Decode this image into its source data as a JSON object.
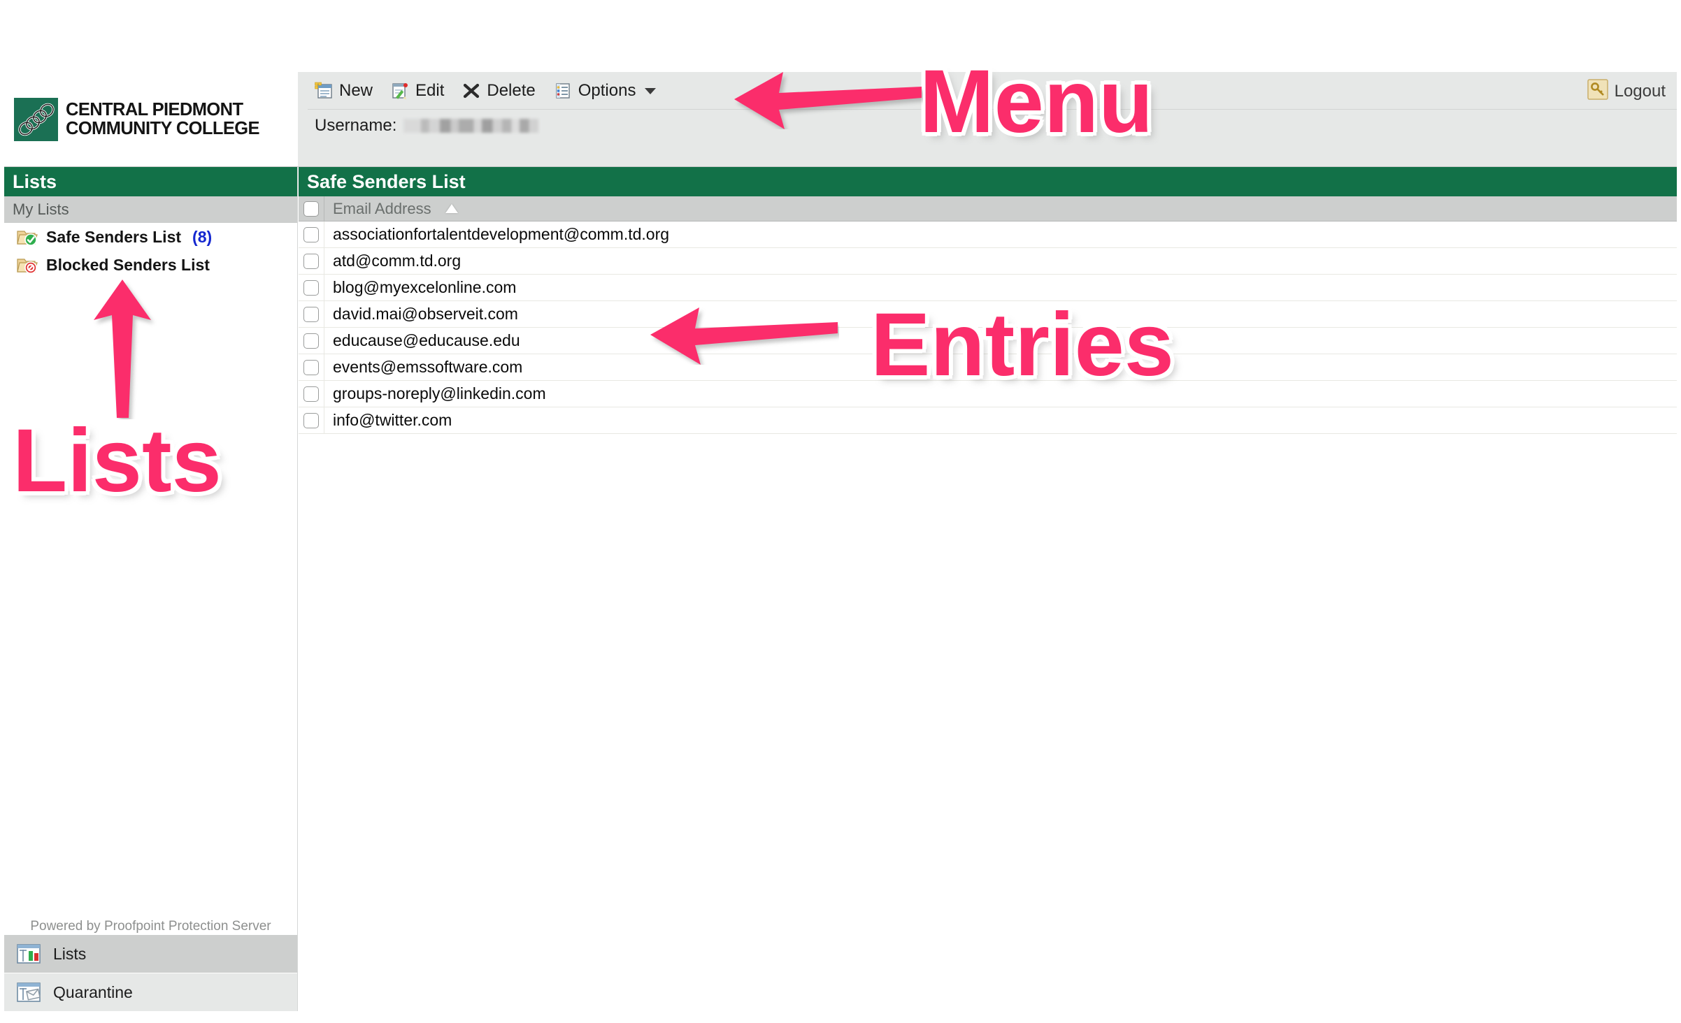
{
  "brand": {
    "logo_line1": "CENTRAL PIEDMONT",
    "logo_line2": "COMMUNITY COLLEGE",
    "logo_mark_alt": "cpcc-logo-icon",
    "green": "#127148"
  },
  "toolbar": {
    "items": [
      {
        "label": "New",
        "icon": "new-document-icon"
      },
      {
        "label": "Edit",
        "icon": "edit-pencil-icon"
      },
      {
        "label": "Delete",
        "icon": "delete-x-icon"
      },
      {
        "label": "Options",
        "icon": "options-list-icon",
        "has_caret": true
      }
    ],
    "username_label": "Username:",
    "username_value": "",
    "logout_label": "Logout",
    "logout_icon": "key-icon"
  },
  "sidebar": {
    "header": "Lists",
    "group_label": "My Lists",
    "items": [
      {
        "label": "Safe Senders List",
        "count": "(8)",
        "icon": "folder-check-icon",
        "selected": true
      },
      {
        "label": "Blocked Senders List",
        "count": "",
        "icon": "folder-block-icon",
        "selected": false
      }
    ],
    "powered_by": "Powered by Proofpoint Protection Server",
    "nav": [
      {
        "label": "Lists",
        "icon": "lists-window-icon",
        "active": true
      },
      {
        "label": "Quarantine",
        "icon": "quarantine-envelope-icon",
        "active": false
      }
    ]
  },
  "main": {
    "header": "Safe Senders List",
    "column_header": "Email Address",
    "sort_indicator": "ascending",
    "select_all_checked": false,
    "rows": [
      {
        "email": "associationfortalentdevelopment@comm.td.org",
        "checked": false
      },
      {
        "email": "atd@comm.td.org",
        "checked": false
      },
      {
        "email": "blog@myexcelonline.com",
        "checked": false
      },
      {
        "email": "david.mai@observeit.com",
        "checked": false
      },
      {
        "email": "educause@educause.edu",
        "checked": false
      },
      {
        "email": "events@emssoftware.com",
        "checked": false
      },
      {
        "email": "groups-noreply@linkedin.com",
        "checked": false
      },
      {
        "email": "info@twitter.com",
        "checked": false
      }
    ]
  },
  "annotations": {
    "color": "#fb2d6b",
    "labels": [
      {
        "id": "menu",
        "text": "Menu",
        "arrow": "arrow-left"
      },
      {
        "id": "entries",
        "text": "Entries",
        "arrow": "arrow-left"
      },
      {
        "id": "lists",
        "text": "Lists",
        "arrow": "arrow-up"
      }
    ]
  }
}
